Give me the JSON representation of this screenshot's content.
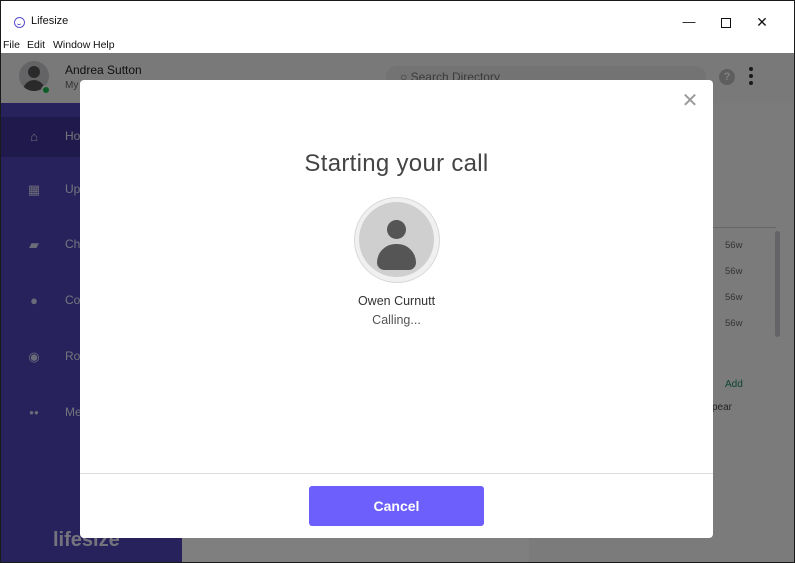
{
  "window": {
    "title": "Lifesize",
    "controls": {
      "minimize": "—",
      "maximize": "",
      "close": "✕"
    }
  },
  "menu": {
    "items": [
      "File",
      "Edit",
      "Window",
      "Help"
    ]
  },
  "header": {
    "user_name": "Andrea Sutton",
    "user_sub": "My",
    "search_placeholder": "Search Directory",
    "help_label": "?"
  },
  "sidebar": {
    "items": [
      {
        "label": "Ho",
        "icon": "home-icon",
        "glyph": "⌂"
      },
      {
        "label": "Up",
        "icon": "calendar-icon",
        "glyph": "▦"
      },
      {
        "label": "Ch",
        "icon": "chat-icon",
        "glyph": "▰"
      },
      {
        "label": "Co",
        "icon": "contacts-icon",
        "glyph": "●"
      },
      {
        "label": "Ro",
        "icon": "room-icon",
        "glyph": "◉"
      },
      {
        "label": "Me",
        "icon": "meetings-icon",
        "glyph": "●●"
      }
    ],
    "logo_text": "lifesize"
  },
  "right_panel": {
    "times": [
      "56w",
      "56w",
      "56w",
      "56w"
    ],
    "add_label": "Add",
    "appear_text": "pear"
  },
  "modal": {
    "title": "Starting your call",
    "callee_name": "Owen Curnutt",
    "status": "Calling...",
    "cancel_label": "Cancel",
    "close_glyph": "✕"
  },
  "colors": {
    "sidebar": "#4f44b8",
    "accent": "#6c5ffc",
    "presence": "#1db954"
  }
}
